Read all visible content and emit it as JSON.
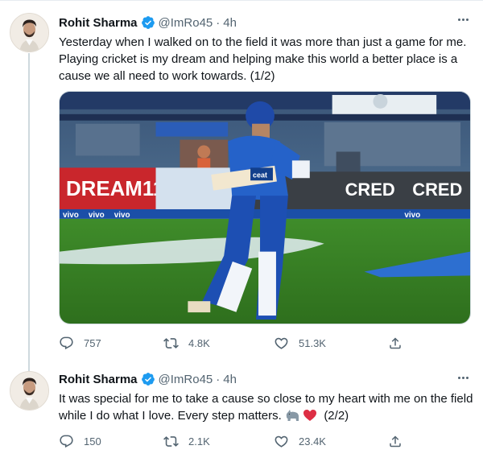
{
  "tweets": [
    {
      "author": {
        "name": "Rohit Sharma",
        "handle": "@ImRo45"
      },
      "separator": "·",
      "time": "4h",
      "text": "Yesterday when I walked on to the field it was more than just a game for me. Playing cricket is my dream and helping make this world a better place is a cause we all need to work towards. (1/2)",
      "media": {
        "banner_texts": [
          "DREAM11",
          "CRED",
          "CRED",
          "ceat",
          "vivo"
        ]
      },
      "stats": {
        "replies": "757",
        "retweets": "4.8K",
        "likes": "51.3K"
      }
    },
    {
      "author": {
        "name": "Rohit Sharma",
        "handle": "@ImRo45"
      },
      "separator": "·",
      "time": "4h",
      "text": "It was special for me to take a cause so close to my heart with me on the field while I do what I love. Every step matters.",
      "text_suffix": "(2/2)",
      "stats": {
        "replies": "150",
        "retweets": "2.1K",
        "likes": "23.4K"
      }
    }
  ],
  "icons": {
    "verified": "verified-badge-icon",
    "more": "more-options-icon",
    "reply": "reply-icon",
    "retweet": "retweet-icon",
    "like": "heart-icon",
    "share": "share-icon",
    "rhino_emoji": "rhino-emoji-icon",
    "heart_emoji": "red-heart-emoji-icon"
  },
  "colors": {
    "text": "#0f1419",
    "secondary": "#536471",
    "verified": "#1d9bf0",
    "border": "#cfd9de",
    "heart": "#e0245e"
  }
}
